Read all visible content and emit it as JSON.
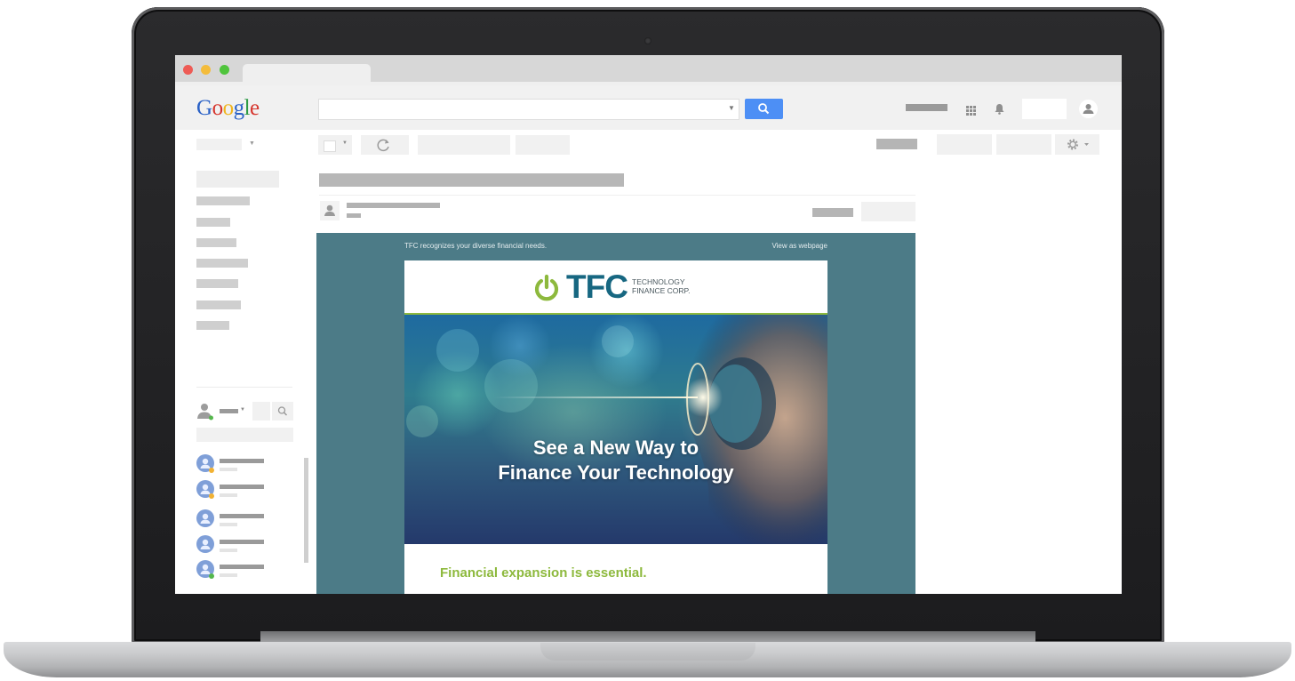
{
  "window": {
    "traffic_lights": [
      "#ee5b55",
      "#f4bc3b",
      "#4fc43c"
    ]
  },
  "google_bar": {
    "logo": {
      "letters": [
        "G",
        "o",
        "o",
        "g",
        "l",
        "e"
      ],
      "colors": [
        "#2a61c6",
        "#d6352d",
        "#f0b51e",
        "#2a61c6",
        "#2c9a45",
        "#d6352d"
      ]
    },
    "search_placeholder": "",
    "icons": [
      "search-icon",
      "apps-grid-icon",
      "bell-icon",
      "account-icon"
    ]
  },
  "toolbar": {
    "icons": [
      "refresh-icon",
      "gear-icon"
    ]
  },
  "email": {
    "preheader_left": "TFC recognizes your diverse financial needs.",
    "preheader_right": "View as webpage",
    "brand_letters": "TFC",
    "brand_line1": "TECHNOLOGY",
    "brand_line2": "FINANCE CORP.",
    "hero_line1": "See a New Way to",
    "hero_line2": "Finance Your Technology",
    "body_heading": "Financial expansion is essential.",
    "colors": {
      "background": "#4c7b87",
      "accent": "#8db93d",
      "brand_blue": "#176781"
    }
  }
}
